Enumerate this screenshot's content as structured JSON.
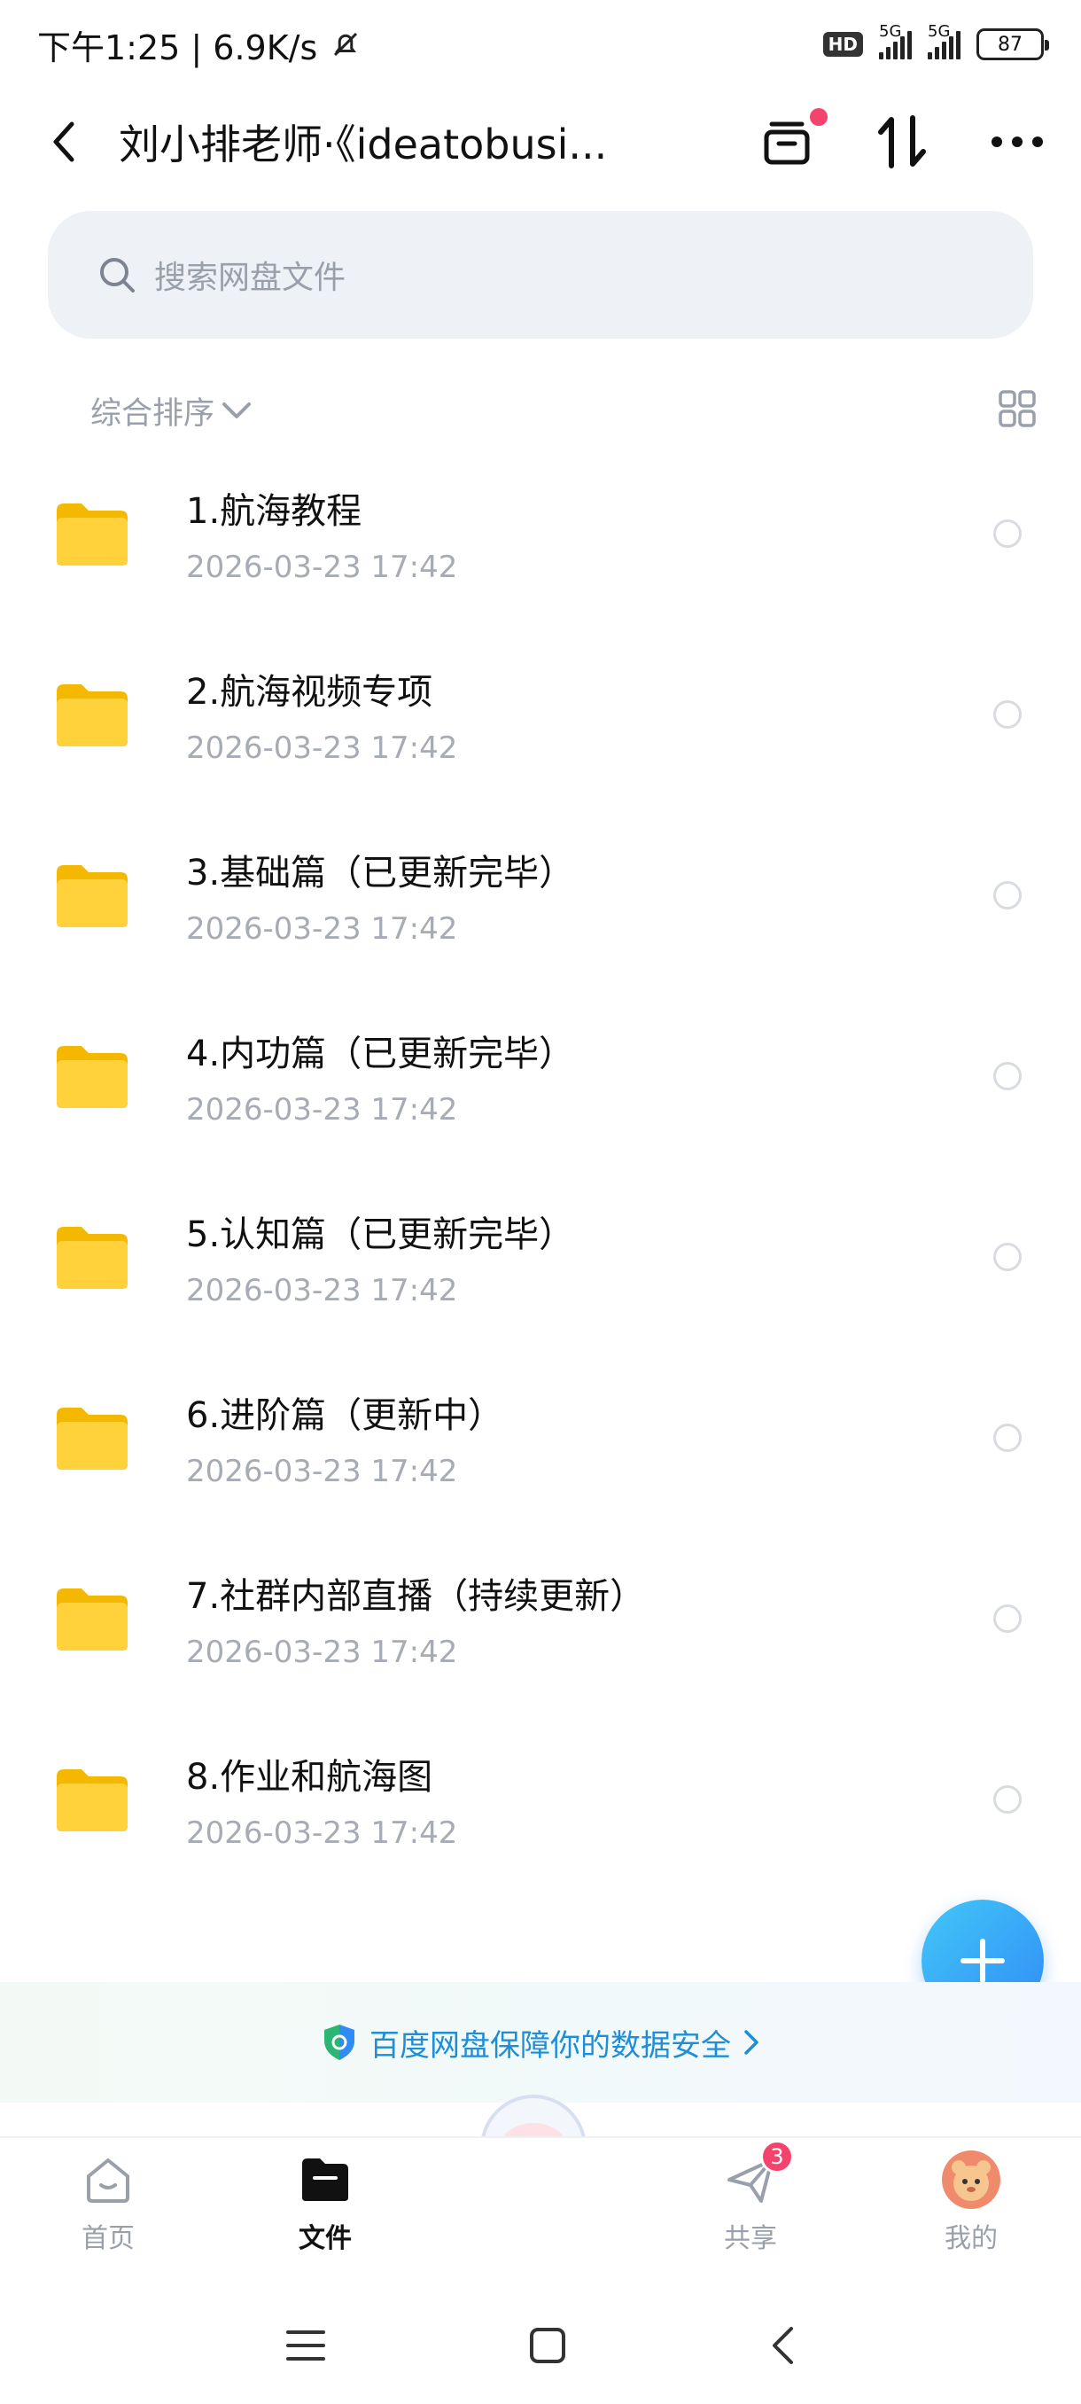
{
  "status_bar": {
    "time_speed": "下午1:25 | 6.9K/s",
    "hd": "HD",
    "network_1": "5G",
    "network_2": "5G",
    "battery": "87"
  },
  "header": {
    "title": "刘小排老师·《ideatobusi..."
  },
  "search": {
    "placeholder": "搜索网盘文件"
  },
  "sort": {
    "label": "综合排序"
  },
  "files": [
    {
      "name": "1.航海教程",
      "date": "2026-03-23  17:42"
    },
    {
      "name": "2.航海视频专项",
      "date": "2026-03-23  17:42"
    },
    {
      "name": "3.基础篇（已更新完毕）",
      "date": "2026-03-23  17:42"
    },
    {
      "name": "4.内功篇（已更新完毕）",
      "date": "2026-03-23  17:42"
    },
    {
      "name": "5.认知篇（已更新完毕）",
      "date": "2026-03-23  17:42"
    },
    {
      "name": "6.进阶篇（更新中）",
      "date": "2026-03-23  17:42"
    },
    {
      "name": "7.社群内部直播（持续更新）",
      "date": "2026-03-23  17:42"
    },
    {
      "name": "8.作业和航海图",
      "date": "2026-03-23  17:42"
    }
  ],
  "banner": {
    "text": "百度网盘保障你的数据安全"
  },
  "tabs": {
    "home": "首页",
    "files": "文件",
    "share": "共享",
    "share_badge": "3",
    "mine": "我的"
  },
  "colors": {
    "folder": "#ffcf3f",
    "accent": "#2f8cf7",
    "badge": "#f4436c"
  },
  "icons": [
    "back-icon",
    "archive-icon",
    "sort-transfer-icon",
    "more-icon",
    "search-icon",
    "chevron-down-icon",
    "grid-view-icon",
    "folder-icon",
    "plus-icon",
    "shield-icon",
    "home-icon",
    "files-icon",
    "share-icon",
    "avatar-icon",
    "menu-icon",
    "square-icon"
  ]
}
